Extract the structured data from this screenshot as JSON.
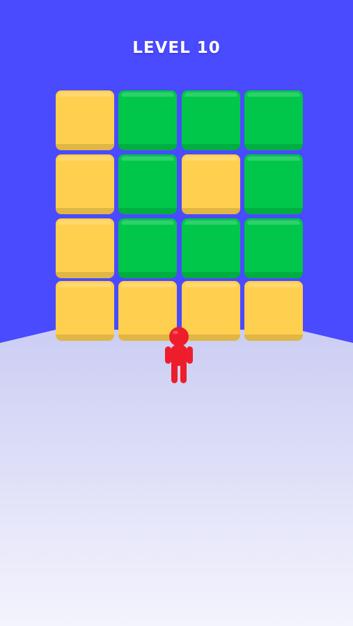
{
  "hud": {
    "level_label": "LEVEL 10"
  },
  "colors": {
    "sky": "#4a4aff",
    "floor_top": "#cbcdf3",
    "floor_bottom": "#f4f4fd",
    "tile_yellow": "#ffd04f",
    "tile_green": "#00c74a",
    "runner": "#ee1d2b"
  },
  "board": {
    "rows": 4,
    "columns": 4,
    "tiles": [
      [
        "yellow",
        "green",
        "green",
        "green"
      ],
      [
        "yellow",
        "green",
        "yellow",
        "green"
      ],
      [
        "yellow",
        "green",
        "green",
        "green"
      ],
      [
        "yellow",
        "yellow",
        "yellow",
        "yellow"
      ]
    ]
  },
  "player": {
    "icon": "stickman-icon"
  }
}
